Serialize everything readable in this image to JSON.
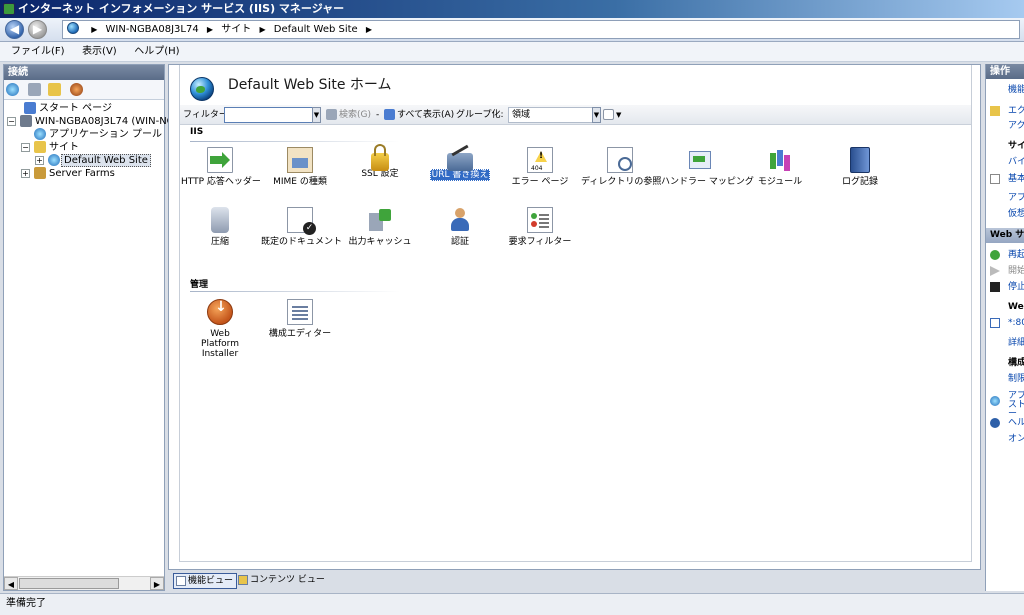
{
  "window": {
    "title": "インターネット インフォメーション サービス (IIS) マネージャー"
  },
  "address": {
    "parts": [
      "WIN-NGBA08J3L74",
      "サイト",
      "Default Web Site"
    ]
  },
  "menu": [
    "ファイル(F)",
    "表示(V)",
    "ヘルプ(H)"
  ],
  "left_panel": {
    "title": "接続",
    "tree": {
      "start_page": "スタート ページ",
      "server": "WIN-NGBA08J3L74 (WIN-NGE",
      "app_pools": "アプリケーション プール",
      "sites": "サイト",
      "default_site": "Default Web Site",
      "server_farms": "Server Farms"
    }
  },
  "main": {
    "title": "Default Web Site ホーム",
    "filter": {
      "label": "フィルター:",
      "value": "",
      "search_label": "検索(G)",
      "show_all_label": "すべて表示(A)",
      "group_by_label": "グループ化:",
      "group_by_value": "領域"
    },
    "sections": {
      "iis": "IIS",
      "management": "管理"
    },
    "iis_features": [
      "HTTP 応答ヘッダー",
      "MIME の種類",
      "SSL 設定",
      "URL 書き換え",
      "エラー ページ",
      "ディレクトリの参照",
      "ハンドラー マッピング",
      "モジュール",
      "ログ記録",
      "圧縮",
      "既定のドキュメント",
      "出力キャッシュ",
      "認証",
      "要求フィルター"
    ],
    "management_features": [
      "Web Platform Installer",
      "構成エディター"
    ]
  },
  "view_tabs": {
    "features": "機能ビュー",
    "content": "コンテンツ ビュー"
  },
  "right_panel": {
    "title": "操作",
    "items": [
      "機能",
      "エク",
      "アク",
      "サイ",
      "バイ",
      "基本",
      "アプ",
      "仮想"
    ],
    "web_site_head": "Web サ",
    "site_items": [
      "再起",
      "開始",
      "停止",
      "Web",
      "*:80",
      "詳細",
      "構成",
      "制限",
      "アプ ストー",
      "ヘル",
      "オン"
    ]
  },
  "status": {
    "text": "準備完了"
  },
  "colors": {
    "accent": "#316ac5",
    "link": "#0645ad",
    "panel_head": "#5a6c88"
  }
}
